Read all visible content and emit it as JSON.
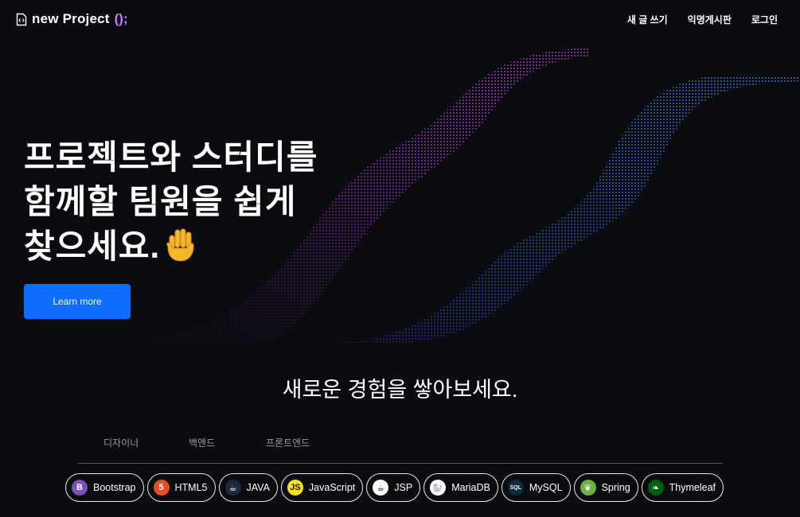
{
  "brand": {
    "name": "new Project",
    "parens": "();",
    "icon": "code-file-icon"
  },
  "nav": [
    {
      "label": "새 글 쓰기"
    },
    {
      "label": "익명게시판"
    },
    {
      "label": "로그인"
    }
  ],
  "hero": {
    "title_lines": [
      "프로젝트와 스터디를",
      "함께할 팀원을 쉽게",
      "찾으세요."
    ],
    "emoji": "waving-hand-icon",
    "button_label": "Learn more"
  },
  "section": {
    "title": "새로운 경험을 쌓아보세요.",
    "tabs": [
      {
        "label": "디자이너"
      },
      {
        "label": "백엔드"
      },
      {
        "label": "프론트엔드"
      }
    ],
    "tech": [
      {
        "label": "Bootstrap",
        "icon": "bootstrap-icon",
        "color": "#7952b3",
        "glyph": "B"
      },
      {
        "label": "HTML5",
        "icon": "html5-icon",
        "color": "#e44d26",
        "glyph": "5"
      },
      {
        "label": "JAVA",
        "icon": "java-icon",
        "color": "#1b2a3a",
        "glyph": "☕"
      },
      {
        "label": "JavaScript",
        "icon": "javascript-icon",
        "color": "#f7df1e",
        "glyph": "JS"
      },
      {
        "label": "JSP",
        "icon": "jsp-icon",
        "color": "#ffffff",
        "glyph": "☕"
      },
      {
        "label": "MariaDB",
        "icon": "mariadb-icon",
        "color": "#ffffff",
        "glyph": "🦭"
      },
      {
        "label": "MySQL",
        "icon": "mysql-icon",
        "color": "#0b2a3a",
        "glyph": "SQL"
      },
      {
        "label": "Spring",
        "icon": "spring-icon",
        "color": "#6db33f",
        "glyph": "❦"
      },
      {
        "label": "Thymeleaf",
        "icon": "thymeleaf-icon",
        "color": "#005f0f",
        "glyph": "❧"
      }
    ]
  },
  "colors": {
    "accent": "#0d6efd",
    "brand_parens": "#c77dff",
    "wave_purple": "#b23df0",
    "wave_blue": "#3d5fff"
  }
}
